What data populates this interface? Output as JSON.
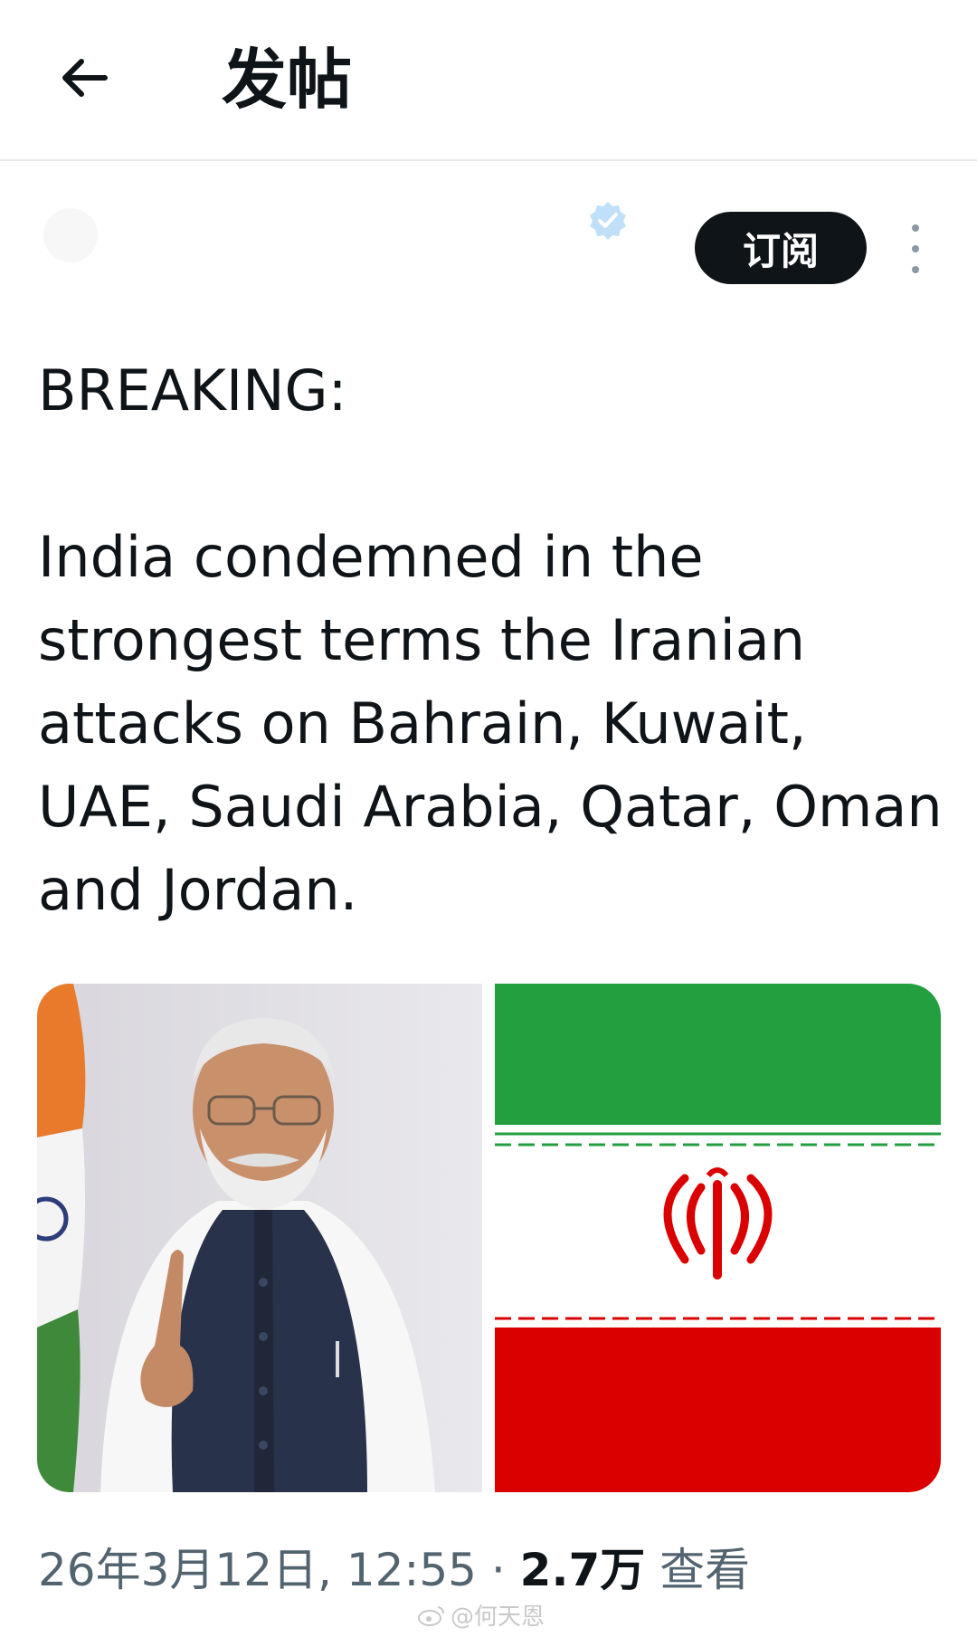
{
  "header": {
    "title": "发帖"
  },
  "author": {
    "subscribe_label": "订阅"
  },
  "post": {
    "lead": "BREAKING:",
    "body": "India condemned in the strongest terms the Iranian attacks on Bahrain, Kuwait, UAE, Saudi Arabia, Qatar, Oman and Jordan.",
    "media": [
      {
        "icon": "person-photo"
      },
      {
        "icon": "iran-flag"
      }
    ],
    "timestamp": "26年3月12日, 12:55",
    "separator": "·",
    "views_count": "2.7万",
    "views_label": "查看"
  },
  "watermark": {
    "text": "@何天恩"
  },
  "colors": {
    "subscribe_bg": "#0f1419",
    "verified": "#1d9bf0",
    "flag_green": "#239f40",
    "flag_red": "#da0000"
  }
}
